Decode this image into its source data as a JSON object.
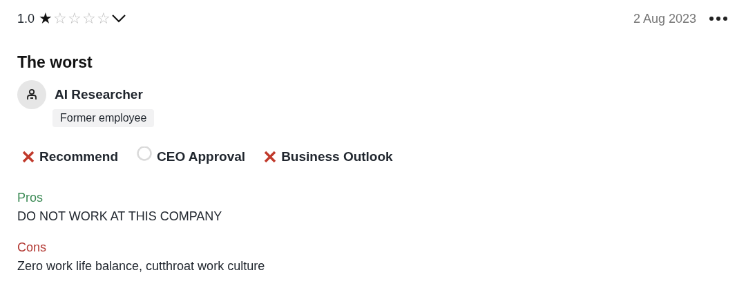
{
  "review": {
    "rating": "1.0",
    "stars": 1,
    "date": "2 Aug 2023",
    "title": "The worst",
    "author": {
      "role": "AI Researcher",
      "status": "Former employee"
    },
    "ratings": [
      {
        "label": "Recommend",
        "kind": "negative"
      },
      {
        "label": "CEO Approval",
        "kind": "neutral"
      },
      {
        "label": "Business Outlook",
        "kind": "negative"
      }
    ],
    "pros": {
      "heading": "Pros",
      "text": "DO NOT WORK AT THIS COMPANY"
    },
    "cons": {
      "heading": "Cons",
      "text": "Zero work life balance, cutthroat work culture"
    }
  }
}
